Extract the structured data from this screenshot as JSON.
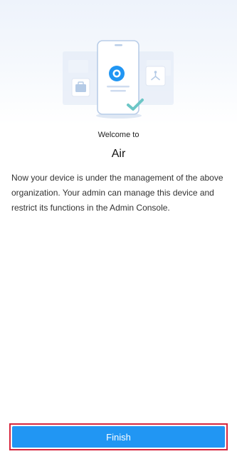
{
  "welcome": {
    "subtitle": "Welcome to",
    "organization": "Air",
    "description": "Now your device is under the management of the above organization. Your admin can manage this device and restrict its functions in the Admin Console."
  },
  "actions": {
    "finish_label": "Finish"
  },
  "illustration": {
    "icons": [
      "briefcase-icon",
      "phone-icon",
      "app-logo-icon",
      "checkmark-icon",
      "share-icon"
    ]
  },
  "colors": {
    "accent": "#2196f3",
    "highlight_border": "#d7263d",
    "check": "#6cc6c6"
  }
}
